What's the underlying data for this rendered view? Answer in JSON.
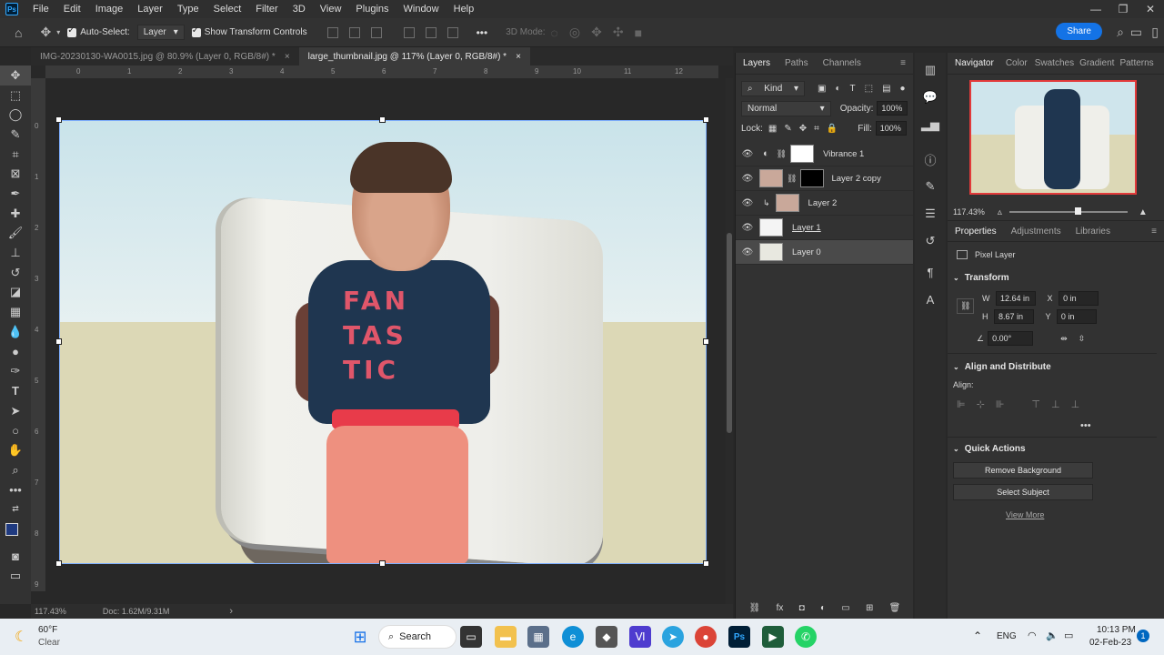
{
  "menubar": {
    "logo": "Ps",
    "items": [
      "File",
      "Edit",
      "Image",
      "Layer",
      "Type",
      "Select",
      "Filter",
      "3D",
      "View",
      "Plugins",
      "Window",
      "Help"
    ]
  },
  "options": {
    "auto_select_label": "Auto-Select:",
    "auto_select_value": "Layer",
    "show_transform_label": "Show Transform Controls",
    "mode_3d_label": "3D Mode:",
    "share_label": "Share",
    "more": "•••"
  },
  "tabs": [
    {
      "label": "IMG-20230130-WA0015.jpg @ 80.9% (Layer 0, RGB/8#) *",
      "close": "×"
    },
    {
      "label": "large_thumbnail.jpg @ 117% (Layer 0, RGB/8#) *",
      "close": "×"
    }
  ],
  "ruler_top": [
    "0",
    "1",
    "2",
    "3",
    "4",
    "5",
    "6",
    "7",
    "8",
    "9",
    "10",
    "11",
    "12"
  ],
  "ruler_left": [
    "0",
    "1",
    "2",
    "3",
    "4",
    "5",
    "6",
    "7",
    "8",
    "9"
  ],
  "shirt_text": "FAN TAS TIC",
  "status": {
    "zoom": "117.43%",
    "doc": "Doc: 1.62M/9.31M",
    "arrow": "›"
  },
  "layers_panel": {
    "tabs": [
      "Layers",
      "Paths",
      "Channels"
    ],
    "filter_kind": "Kind",
    "blend_mode": "Normal",
    "opacity_label": "Opacity:",
    "opacity_value": "100%",
    "lock_label": "Lock:",
    "fill_label": "Fill:",
    "fill_value": "100%",
    "layers": [
      {
        "name": "Vibrance 1"
      },
      {
        "name": "Layer 2 copy"
      },
      {
        "name": "Layer 2"
      },
      {
        "name": "Layer 1"
      },
      {
        "name": "Layer 0"
      }
    ]
  },
  "navigator": {
    "tabs": [
      "Navigator",
      "Color",
      "Swatches",
      "Gradient",
      "Patterns"
    ],
    "zoom": "117.43%"
  },
  "properties": {
    "tabs": [
      "Properties",
      "Adjustments",
      "Libraries"
    ],
    "type_label": "Pixel Layer",
    "transform_label": "Transform",
    "w_label": "W",
    "w_value": "12.64 in",
    "h_label": "H",
    "h_value": "8.67 in",
    "x_label": "X",
    "x_value": "0 in",
    "y_label": "Y",
    "y_value": "0 in",
    "angle_value": "0.00°",
    "align_section": "Align and Distribute",
    "align_label": "Align:",
    "quick_actions": "Quick Actions",
    "remove_bg": "Remove Background",
    "select_subject": "Select Subject",
    "view_more": "View More"
  },
  "taskbar": {
    "temp": "60°F",
    "weather": "Clear",
    "search": "Search",
    "lang": "ENG",
    "time": "10:13 PM",
    "date": "02-Feb-23",
    "notif": "1"
  }
}
